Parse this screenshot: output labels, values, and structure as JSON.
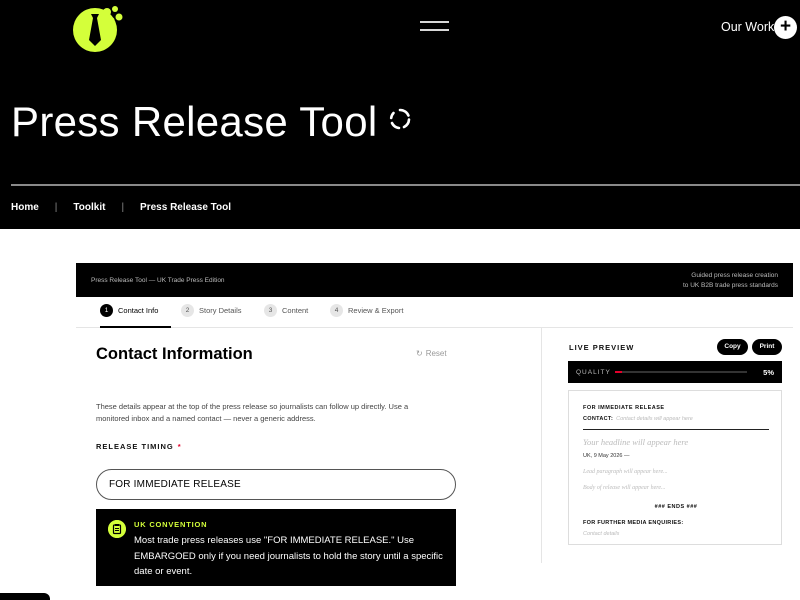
{
  "header": {
    "logo_icon": "lightbulb-tie-logo",
    "accent_color": "#d4ff3a",
    "menu_icon": "hamburger-icon",
    "our_work_label": "Our Work",
    "our_work_icon": "plus-icon"
  },
  "hero": {
    "title": "Press Release Tool",
    "spinner_icon": "loading-spinner-icon"
  },
  "breadcrumbs": [
    "Home",
    "Toolkit",
    "Press Release Tool"
  ],
  "tool": {
    "bar_left": "Press Release Tool — UK Trade Press Edition",
    "bar_right_1": "Guided press release creation",
    "bar_right_2": "to UK B2B trade press standards",
    "tabs": [
      {
        "num": "1",
        "label": "Contact Info",
        "active": true
      },
      {
        "num": "2",
        "label": "Story Details",
        "active": false
      },
      {
        "num": "3",
        "label": "Content",
        "active": false
      },
      {
        "num": "4",
        "label": "Review & Export",
        "active": false
      }
    ]
  },
  "form": {
    "title": "Contact Information",
    "reset_icon": "reset-icon",
    "reset_label": "Reset",
    "description": "These details appear at the top of the press release so journalists can follow up directly. Use a monitored inbox and a named contact — never a generic address.",
    "timing_label": "RELEASE TIMING",
    "required_mark": "*",
    "timing_value": "FOR IMMEDIATE RELEASE",
    "callout": {
      "icon": "clipboard-icon",
      "title": "UK CONVENTION",
      "body": "Most trade press releases use \"FOR IMMEDIATE RELEASE.\" Use EMBARGOED only if you need journalists to hold the story until a specific date or event."
    }
  },
  "preview": {
    "label": "LIVE PREVIEW",
    "copy_label": "Copy",
    "print_label": "Print",
    "quality_label": "QUALITY",
    "quality_value": "5%",
    "quality_fraction": 0.05,
    "quality_color": "#e4002b",
    "doc": {
      "immediate": "FOR IMMEDIATE RELEASE",
      "contact_label": "CONTACT:",
      "contact_placeholder": "Contact details will appear here",
      "headline_placeholder": "Your headline will appear here",
      "dateline": "UK, 9 May 2026 —",
      "lead_placeholder": "Lead paragraph will appear here...",
      "body_placeholder": "Body of release will appear here...",
      "ends": "### ENDS ###",
      "further": "FOR FURTHER MEDIA ENQUIRIES:",
      "contact_details_placeholder": "Contact details"
    }
  }
}
